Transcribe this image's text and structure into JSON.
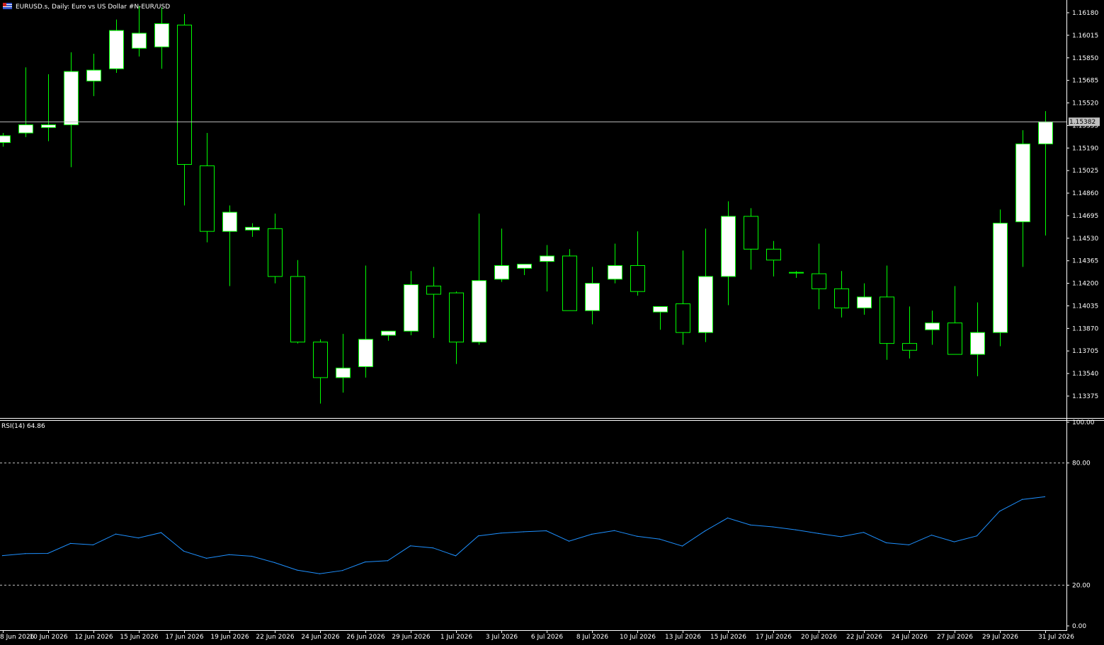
{
  "title": "EURUSD.s, Daily:  Euro vs US Dollar #N-EUR/USD",
  "rsi_label": "RSI(14) 64.86",
  "current_price": "1.15382",
  "colors": {
    "background": "#000000",
    "bull_fill": "#ffffff",
    "candle_outline": "#00ff00",
    "rsi_line": "#1e90ff",
    "price_line": "#c0c0c0",
    "axis_text": "#ffffff",
    "level_lines": "#c0c0c0"
  },
  "chart_data": [
    {
      "type": "candlestick",
      "symbol": "EURUSD.s",
      "timeframe": "Daily",
      "y_ticks": [
        "1.16180",
        "1.16015",
        "1.15850",
        "1.15685",
        "1.15520",
        "1.15355",
        "1.15190",
        "1.15025",
        "1.14860",
        "1.14695",
        "1.14530",
        "1.14365",
        "1.14200",
        "1.14035",
        "1.13870",
        "1.13705",
        "1.13540",
        "1.13375"
      ],
      "ylim": [
        1.1329,
        1.1625
      ],
      "x_labels": [
        "8 Jun 2026",
        "10 Jun 2026",
        "12 Jun 2026",
        "15 Jun 2026",
        "17 Jun 2026",
        "19 Jun 2026",
        "22 Jun 2026",
        "24 Jun 2026",
        "26 Jun 2026",
        "29 Jun 2026",
        "1 Jul 2026",
        "3 Jul 2026",
        "6 Jul 2026",
        "8 Jul 2026",
        "10 Jul 2026",
        "13 Jul 2026",
        "15 Jul 2026",
        "17 Jul 2026",
        "20 Jul 2026",
        "22 Jul 2026",
        "24 Jul 2026",
        "27 Jul 2026",
        "29 Jul 2026",
        "31 Jul 2026"
      ],
      "candles": [
        {
          "o": 1.1523,
          "h": 1.153,
          "l": 1.152,
          "c": 1.1528
        },
        {
          "o": 1.153,
          "h": 1.1578,
          "l": 1.1527,
          "c": 1.1536
        },
        {
          "o": 1.1534,
          "h": 1.1573,
          "l": 1.1524,
          "c": 1.1536
        },
        {
          "o": 1.1536,
          "h": 1.1589,
          "l": 1.1505,
          "c": 1.1575
        },
        {
          "o": 1.1568,
          "h": 1.1588,
          "l": 1.1557,
          "c": 1.1576
        },
        {
          "o": 1.1577,
          "h": 1.1613,
          "l": 1.1574,
          "c": 1.1605
        },
        {
          "o": 1.1592,
          "h": 1.1623,
          "l": 1.1586,
          "c": 1.1603
        },
        {
          "o": 1.1593,
          "h": 1.1622,
          "l": 1.1577,
          "c": 1.161
        },
        {
          "o": 1.1609,
          "h": 1.1617,
          "l": 1.1477,
          "c": 1.1507
        },
        {
          "o": 1.1506,
          "h": 1.153,
          "l": 1.145,
          "c": 1.1458
        },
        {
          "o": 1.1458,
          "h": 1.1477,
          "l": 1.1418,
          "c": 1.1472
        },
        {
          "o": 1.1459,
          "h": 1.1464,
          "l": 1.1454,
          "c": 1.1461
        },
        {
          "o": 1.146,
          "h": 1.1471,
          "l": 1.142,
          "c": 1.1425
        },
        {
          "o": 1.1425,
          "h": 1.1437,
          "l": 1.1376,
          "c": 1.1377
        },
        {
          "o": 1.1377,
          "h": 1.1379,
          "l": 1.1332,
          "c": 1.1351
        },
        {
          "o": 1.1351,
          "h": 1.1383,
          "l": 1.134,
          "c": 1.1358
        },
        {
          "o": 1.1359,
          "h": 1.1433,
          "l": 1.1351,
          "c": 1.1379
        },
        {
          "o": 1.1382,
          "h": 1.1385,
          "l": 1.1378,
          "c": 1.1385
        },
        {
          "o": 1.1385,
          "h": 1.1429,
          "l": 1.1382,
          "c": 1.1419
        },
        {
          "o": 1.1418,
          "h": 1.1432,
          "l": 1.138,
          "c": 1.1412
        },
        {
          "o": 1.1413,
          "h": 1.1414,
          "l": 1.1361,
          "c": 1.1377
        },
        {
          "o": 1.1377,
          "h": 1.1471,
          "l": 1.1375,
          "c": 1.1422
        },
        {
          "o": 1.1423,
          "h": 1.146,
          "l": 1.1421,
          "c": 1.1433
        },
        {
          "o": 1.1431,
          "h": 1.1434,
          "l": 1.1426,
          "c": 1.1434
        },
        {
          "o": 1.1436,
          "h": 1.1448,
          "l": 1.1414,
          "c": 1.144
        },
        {
          "o": 1.144,
          "h": 1.1445,
          "l": 1.14,
          "c": 1.14
        },
        {
          "o": 1.14,
          "h": 1.1432,
          "l": 1.139,
          "c": 1.142
        },
        {
          "o": 1.1423,
          "h": 1.1449,
          "l": 1.142,
          "c": 1.1433
        },
        {
          "o": 1.1433,
          "h": 1.1458,
          "l": 1.1411,
          "c": 1.1414
        },
        {
          "o": 1.1399,
          "h": 1.1403,
          "l": 1.1386,
          "c": 1.1403
        },
        {
          "o": 1.1405,
          "h": 1.1444,
          "l": 1.1375,
          "c": 1.1384
        },
        {
          "o": 1.1384,
          "h": 1.146,
          "l": 1.1377,
          "c": 1.1425
        },
        {
          "o": 1.1425,
          "h": 1.148,
          "l": 1.1404,
          "c": 1.1469
        },
        {
          "o": 1.1469,
          "h": 1.1475,
          "l": 1.143,
          "c": 1.1445
        },
        {
          "o": 1.1445,
          "h": 1.1451,
          "l": 1.1425,
          "c": 1.1437
        },
        {
          "o": 1.1428,
          "h": 1.1429,
          "l": 1.1424,
          "c": 1.1428
        },
        {
          "o": 1.1427,
          "h": 1.1449,
          "l": 1.1401,
          "c": 1.1416
        },
        {
          "o": 1.1416,
          "h": 1.1429,
          "l": 1.1395,
          "c": 1.1402
        },
        {
          "o": 1.1402,
          "h": 1.142,
          "l": 1.1397,
          "c": 1.141
        },
        {
          "o": 1.141,
          "h": 1.1433,
          "l": 1.1364,
          "c": 1.1376
        },
        {
          "o": 1.1376,
          "h": 1.1403,
          "l": 1.1365,
          "c": 1.1371
        },
        {
          "o": 1.1386,
          "h": 1.14,
          "l": 1.1375,
          "c": 1.1391
        },
        {
          "o": 1.1391,
          "h": 1.1418,
          "l": 1.1368,
          "c": 1.1368
        },
        {
          "o": 1.1368,
          "h": 1.1406,
          "l": 1.1352,
          "c": 1.1384
        },
        {
          "o": 1.1384,
          "h": 1.1474,
          "l": 1.1374,
          "c": 1.1464
        },
        {
          "o": 1.1465,
          "h": 1.1532,
          "l": 1.1432,
          "c": 1.1522
        },
        {
          "o": 1.1522,
          "h": 1.1546,
          "l": 1.1455,
          "c": 1.1538
        }
      ]
    },
    {
      "type": "line",
      "indicator": "RSI(14)",
      "y_ticks": [
        "100.00",
        "80.00",
        "20.00",
        "0.00"
      ],
      "levels": [
        80,
        20
      ],
      "ylim": [
        0,
        100
      ],
      "values": [
        34.5,
        35.5,
        35.6,
        40.5,
        39.8,
        45.1,
        43.2,
        45.8,
        36.7,
        33.2,
        35.0,
        34.2,
        31.1,
        27.4,
        25.6,
        27.2,
        31.4,
        32.0,
        39.3,
        38.3,
        34.4,
        44.2,
        45.6,
        46.2,
        46.7,
        41.6,
        45.0,
        46.8,
        44.0,
        42.6,
        39.2,
        46.6,
        53.0,
        49.6,
        48.6,
        47.2,
        45.4,
        43.8,
        45.9,
        40.8,
        39.8,
        44.6,
        41.3,
        44.2,
        56.3,
        62.1,
        63.4
      ]
    }
  ]
}
